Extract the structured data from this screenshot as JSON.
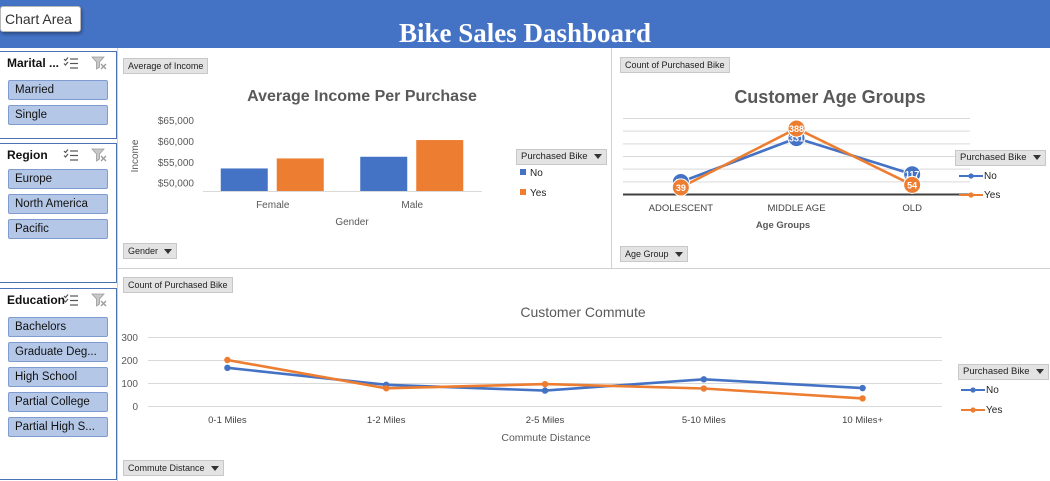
{
  "dashboard": {
    "title": "Bike Sales Dashboard",
    "chart_area_tooltip": "Chart Area"
  },
  "colors": {
    "header_bg": "#4472c4",
    "no": "#4472c4",
    "yes": "#ed7d31",
    "slicer_item_bg": "#b4c7e7",
    "slicer_border": "#4a72b5"
  },
  "icons": {
    "multi_select": "multi-select-icon",
    "clear_filter": "clear-filter-icon",
    "dropdown": "dropdown-arrow-icon"
  },
  "slicers": [
    {
      "title": "Marital ...",
      "items": [
        "Married",
        "Single"
      ]
    },
    {
      "title": "Region",
      "items": [
        "Europe",
        "North America",
        "Pacific"
      ]
    },
    {
      "title": "Education",
      "items": [
        "Bachelors",
        "Graduate Deg...",
        "High School",
        "Partial College",
        "Partial High S..."
      ]
    }
  ],
  "chart_data": [
    {
      "type": "bar",
      "title": "Average Income Per Purchase",
      "field_button": "Average of Income",
      "axis_field_button": "Gender",
      "xlabel": "Gender",
      "ylabel": "Income",
      "categories": [
        "Female",
        "Male"
      ],
      "series": [
        {
          "name": "No",
          "values": [
            53400,
            56200
          ]
        },
        {
          "name": "Yes",
          "values": [
            55800,
            60200
          ]
        }
      ],
      "ylim": [
        48000,
        65000
      ],
      "yticks": [
        50000,
        55000,
        60000,
        65000
      ],
      "ytick_labels": [
        "$50,000",
        "$55,000",
        "$60,000",
        "$65,000"
      ],
      "legend_title": "Purchased Bike",
      "legend_position": "right",
      "grid": false
    },
    {
      "type": "line",
      "title": "Customer Age Groups",
      "field_button": "Count of Purchased Bike",
      "axis_field_button": "Age Group",
      "xlabel": "Age Groups",
      "ylabel": "",
      "categories": [
        "ADOLESCENT",
        "MIDDLE AGE",
        "OLD"
      ],
      "series": [
        {
          "name": "No",
          "values": [
            71,
            331,
            117
          ]
        },
        {
          "name": "Yes",
          "values": [
            39,
            388,
            54
          ]
        }
      ],
      "ylim": [
        0,
        450
      ],
      "legend_title": "Purchased Bike",
      "legend_position": "right",
      "grid": true
    },
    {
      "type": "line",
      "title": "Customer Commute",
      "field_button": "Count of Purchased Bike",
      "axis_field_button": "Commute Distance",
      "xlabel": "Commute Distance",
      "ylabel": "",
      "categories": [
        "0-1 Miles",
        "1-2 Miles",
        "2-5 Miles",
        "5-10 Miles",
        "10 Miles+"
      ],
      "series": [
        {
          "name": "No",
          "values": [
            166,
            92,
            67,
            116,
            78
          ]
        },
        {
          "name": "Yes",
          "values": [
            200,
            77,
            95,
            76,
            33
          ]
        }
      ],
      "ylim": [
        0,
        300
      ],
      "yticks": [
        0,
        100,
        200,
        300
      ],
      "ytick_labels": [
        "0",
        "100",
        "200",
        "300"
      ],
      "legend_title": "Purchased Bike",
      "legend_position": "right",
      "grid": true
    }
  ]
}
